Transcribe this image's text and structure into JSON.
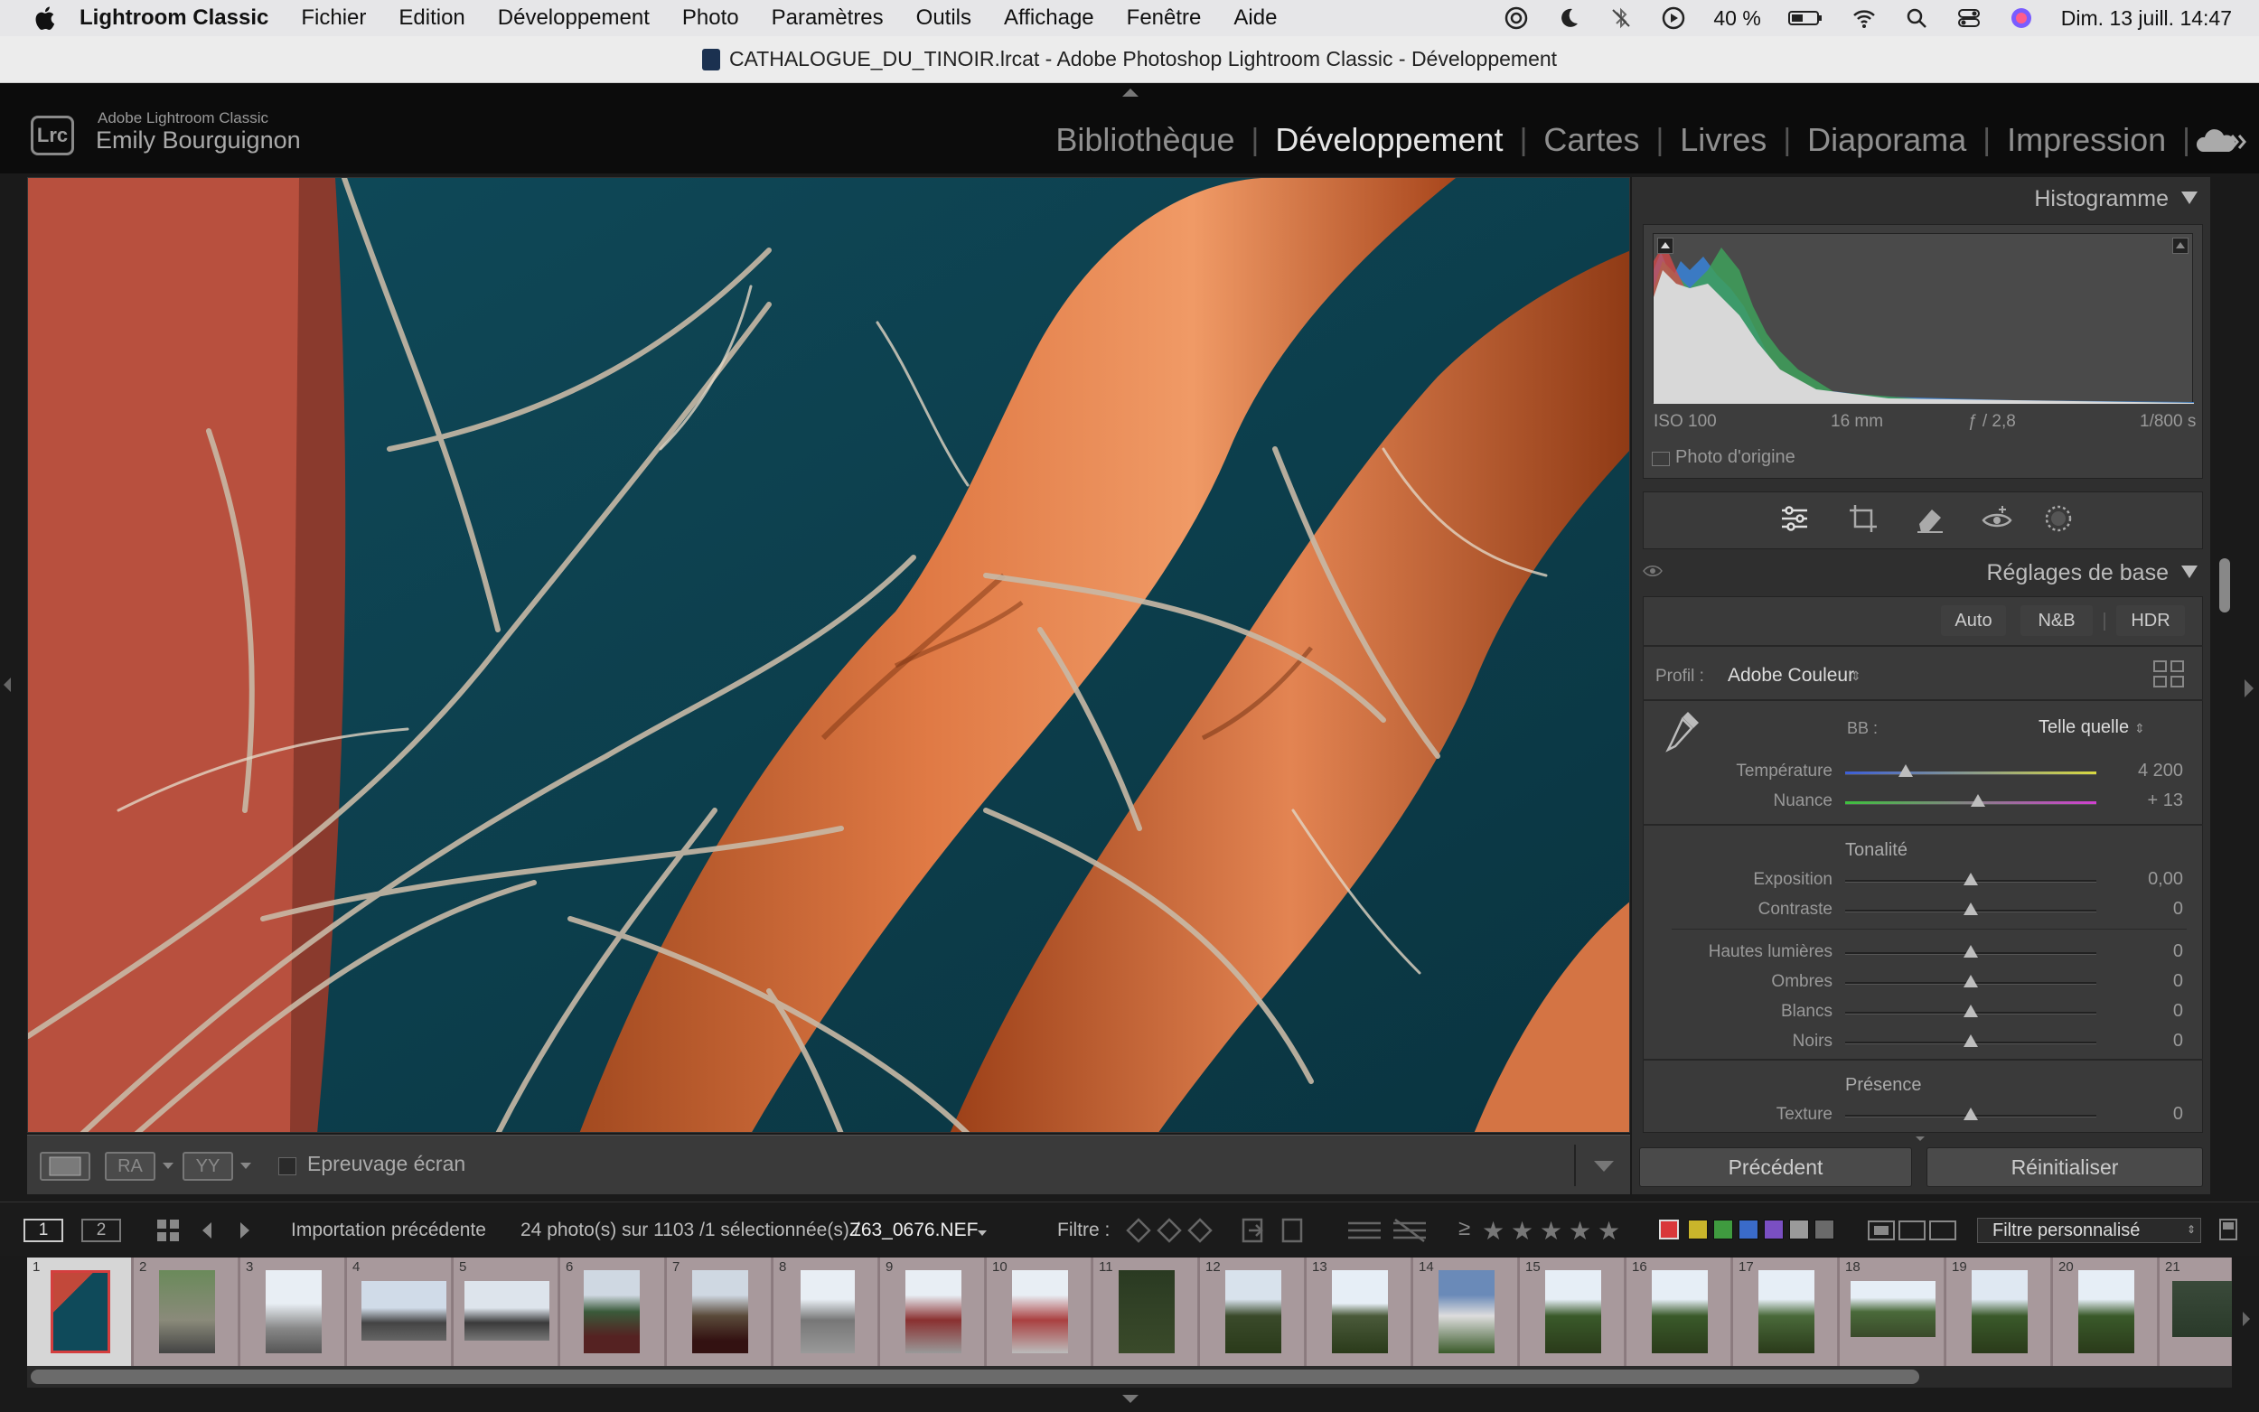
{
  "menubar": {
    "app": "Lightroom Classic",
    "items": [
      "Fichier",
      "Edition",
      "Développement",
      "Photo",
      "Paramètres",
      "Outils",
      "Affichage",
      "Fenêtre",
      "Aide"
    ],
    "battery": "40 %",
    "clock": "Dim. 13 juill. 14:47"
  },
  "window": {
    "title": "CATHALOGUE_DU_TINOIR.lrcat - Adobe Photoshop Lightroom Classic - Développement"
  },
  "identity": {
    "logo": "Lrc",
    "app_name": "Adobe Lightroom Classic",
    "user": "Emily Bourguignon"
  },
  "modules": [
    "Bibliothèque",
    "Développement",
    "Cartes",
    "Livres",
    "Diaporama",
    "Impression"
  ],
  "active_module": "Développement",
  "toolbar": {
    "before_after_1": "RA",
    "before_after_2": "YY",
    "softproof": "Epreuvage écran"
  },
  "histogram": {
    "title": "Histogramme",
    "iso": "ISO 100",
    "focal": "16 mm",
    "aperture": "ƒ / 2,8",
    "shutter": "1/800 s",
    "original_photo": "Photo d'origine"
  },
  "basic": {
    "title": "Réglages de base",
    "buttons": [
      "Auto",
      "N&B",
      "HDR"
    ],
    "profile_label": "Profil :",
    "profile_value": "Adobe Couleur",
    "wb_label": "BB :",
    "wb_value": "Telle quelle",
    "temperature": {
      "label": "Température",
      "value": "4 200",
      "pos": 0.24
    },
    "tint": {
      "label": "Nuance",
      "value": "+ 13",
      "pos": 0.53
    },
    "tone_title": "Tonalité",
    "exposure": {
      "label": "Exposition",
      "value": "0,00",
      "pos": 0.5
    },
    "contrast": {
      "label": "Contraste",
      "value": "0",
      "pos": 0.5
    },
    "highlights": {
      "label": "Hautes lumières",
      "value": "0",
      "pos": 0.5
    },
    "shadows": {
      "label": "Ombres",
      "value": "0",
      "pos": 0.5
    },
    "whites": {
      "label": "Blancs",
      "value": "0",
      "pos": 0.5
    },
    "blacks": {
      "label": "Noirs",
      "value": "0",
      "pos": 0.5
    },
    "presence_title": "Présence",
    "texture": {
      "label": "Texture",
      "value": "0",
      "pos": 0.5
    }
  },
  "footer_buttons": {
    "previous": "Précédent",
    "reset": "Réinitialiser"
  },
  "filmbar": {
    "screen1": "1",
    "screen2": "2",
    "source": "Importation précédente",
    "count": "24 photo(s) sur 1103 /1 sélectionnée(s) /",
    "filename": "Z63_0676.NEF",
    "filter_label": "Filtre :",
    "rating_op": "≥",
    "filter_preset": "Filtre personnalisé",
    "swatches": [
      "#d9383a",
      "#c9b52b",
      "#3f9b3f",
      "#3a6bc9",
      "#7a4fc2",
      "#9a9a9a",
      "#6a6a6a"
    ]
  },
  "filmstrip": {
    "numbers": [
      "1",
      "2",
      "3",
      "4",
      "5",
      "6",
      "7",
      "8",
      "9",
      "10",
      "11",
      "12",
      "13",
      "14",
      "15",
      "16",
      "17",
      "18",
      "19",
      "20",
      "21"
    ]
  }
}
